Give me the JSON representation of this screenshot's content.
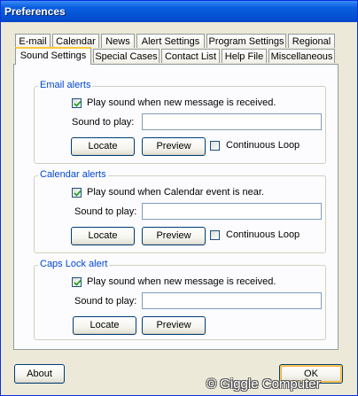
{
  "window": {
    "title": "Preferences"
  },
  "tabs_row1": [
    "E-mail",
    "Calendar",
    "News",
    "Alert Settings",
    "Program Settings",
    "Regional"
  ],
  "tabs_row2": [
    "Sound Settings",
    "Special Cases",
    "Contact List",
    "Help File",
    "Miscellaneous"
  ],
  "active_tab": "Sound Settings",
  "groups": {
    "email": {
      "title": "Email alerts",
      "checkbox_label": "Play sound when new message is received.",
      "checked": true,
      "sound_label": "Sound to play:",
      "sound_value": "",
      "locate": "Locate",
      "preview": "Preview",
      "loop_label": "Continuous Loop",
      "loop_checked": false
    },
    "calendar": {
      "title": "Calendar alerts",
      "checkbox_label": "Play sound when Calendar event is near.",
      "checked": true,
      "sound_label": "Sound to play:",
      "sound_value": "",
      "locate": "Locate",
      "preview": "Preview",
      "loop_label": "Continuous Loop",
      "loop_checked": false
    },
    "capslock": {
      "title": "Caps Lock alert",
      "checkbox_label": "Play sound when new message is received.",
      "checked": true,
      "sound_label": "Sound to play:",
      "sound_value": "",
      "locate": "Locate",
      "preview": "Preview"
    }
  },
  "footer": {
    "about": "About",
    "ok": "OK"
  },
  "watermark": "© Giggle Computer",
  "colors": {
    "accent": "#0046d5",
    "title_bar": "#0453d4",
    "tab_highlight": "#ffc83c"
  }
}
